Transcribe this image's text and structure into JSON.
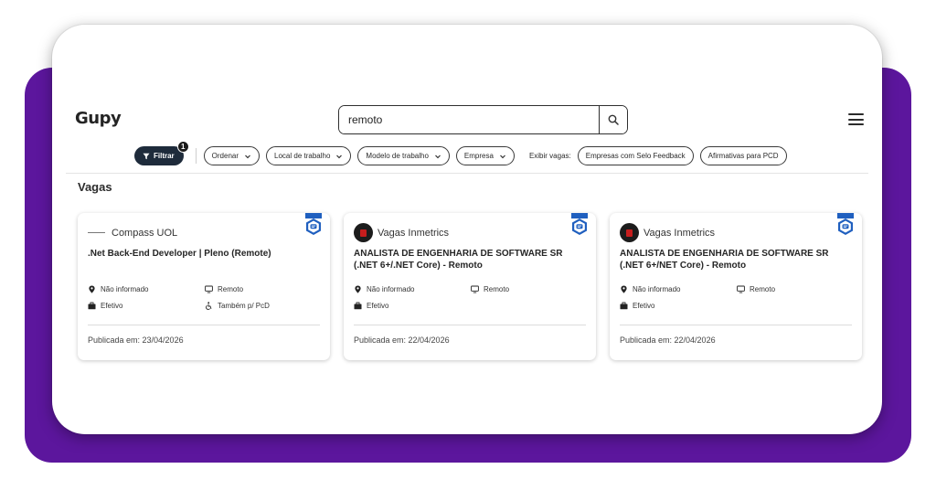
{
  "header": {
    "logo_text": "Gupy",
    "search": {
      "value": "remoto",
      "placeholder": ""
    }
  },
  "filters": {
    "filtrar_label": "Filtrar",
    "filtrar_count": "1",
    "ordenar_label": "Ordenar",
    "local_label": "Local de trabalho",
    "modelo_label": "Modelo de trabalho",
    "empresa_label": "Empresa",
    "exibir_label": "Exibir vagas:",
    "selo_label": "Empresas com Selo Feedback",
    "pcd_label": "Afirmativas para PCD"
  },
  "section_title": "Vagas",
  "jobs": [
    {
      "company": "Compass UOL",
      "title": ".Net Back-End Developer | Pleno (Remote)",
      "location": "Não informado",
      "model": "Remoto",
      "type": "Efetivo",
      "pcd": "Também p/ PcD",
      "published": "Publicada em: 23/04/2026"
    },
    {
      "company": "Vagas Inmetrics",
      "title": "ANALISTA DE ENGENHARIA DE SOFTWARE SR (.NET 6+/.NET Core) - Remoto",
      "location": "Não informado",
      "model": "Remoto",
      "type": "Efetivo",
      "published": "Publicada em: 22/04/2026"
    },
    {
      "company": "Vagas Inmetrics",
      "title": "ANALISTA DE ENGENHARIA DE SOFTWARE SR (.NET 6+/NET Core) - Remoto",
      "location": "Não informado",
      "model": "Remoto",
      "type": "Efetivo",
      "published": "Publicada em: 22/04/2026"
    }
  ],
  "colors": {
    "background_frame": "#5c169d",
    "filter_button": "#1e2b3b",
    "feedback_badge": "#1f5fbf"
  },
  "icons": [
    "search-icon",
    "menu-icon",
    "filter-icon",
    "chevron-down-icon",
    "feedback-seal-icon",
    "location-pin-icon",
    "monitor-icon",
    "briefcase-icon",
    "accessibility-icon"
  ]
}
